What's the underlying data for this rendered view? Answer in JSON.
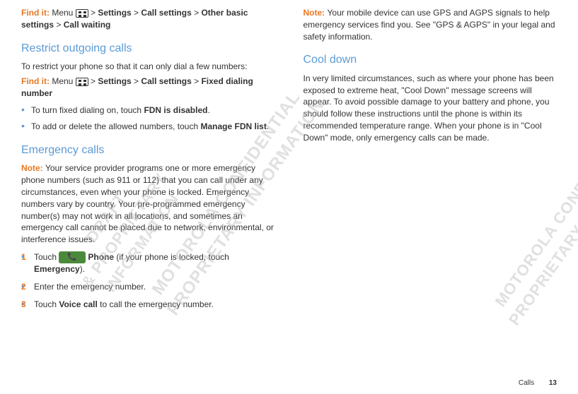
{
  "col1": {
    "find1_prefix": "Find it: ",
    "find1_rest": "Menu ",
    "find1_after_icon": " > ",
    "find1_b1": "Settings",
    "find1_sep": " > ",
    "find1_b2": "Call settings",
    "find1_b3": "Other basic settings",
    "find1_b4": "Call waiting",
    "h1": "Restrict outgoing calls",
    "p1": "To restrict your phone so that it can only dial a few numbers:",
    "find2_prefix": "Find it: ",
    "find2_rest": "Menu ",
    "find2_after_icon": " > ",
    "find2_b1": "Settings",
    "find2_sep": " > ",
    "find2_b2": "Call settings",
    "find2_b3": "Fixed dialing number",
    "bullet1_pre": "To turn fixed dialing on, touch ",
    "bullet1_b": "FDN is disabled",
    "bullet1_post": ".",
    "bullet2_pre": "To add or delete the allowed numbers, touch ",
    "bullet2_b": "Manage FDN list",
    "bullet2_post": ".",
    "h2": "Emergency calls",
    "note_label": "Note: ",
    "note_text": "Your service provider programs one or more emergency phone numbers (such as 911 or 112) that you can call under any circumstances, even when your phone is locked. Emergency numbers vary by country. Your pre-programmed emergency number(s) may not work in all locations, and sometimes an emergency call cannot be placed due to network, environmental, or interference issues.",
    "s1_num": "1",
    "s1_pre": "Touch ",
    "s1_mid": " ",
    "s1_b1": "Phone",
    "s1_after": " (if your phone is locked, touch ",
    "s1_b2": "Emergency",
    "s1_post": ").",
    "s2_num": "2",
    "s2_text": "Enter the emergency number.",
    "s3_num": "3",
    "s3_pre": "Touch ",
    "s3_b": "Voice call",
    "s3_post": " to call the emergency number.",
    "phone_icon": "📞"
  },
  "col2": {
    "note_label": "Note: ",
    "note_text": "Your mobile device can use GPS and AGPS signals to help emergency services find you. See \"GPS & AGPS\" in your legal and safety information.",
    "h1": "Cool down",
    "p1": "In very limited circumstances, such as where your phone has been exposed to extreme heat, \"Cool Down\" message screens will appear. To avoid possible damage to your battery and phone, you should follow these instructions until the phone is within its recommended temperature range. When your phone is in \"Cool Down\" mode, only emergency calls can be made."
  },
  "footer": {
    "section": "Calls",
    "page": "13"
  },
  "watermark1": "DRAFT\n& PROPRIETARY\nINFORMATION",
  "watermark2": "MOTOROLA CONFIDENTIAL\nPROPRIETARY INFORMATION",
  "watermark3": "MOTOROLA CONFIDENTIAL\nPROPRIETARY INFORMATION"
}
